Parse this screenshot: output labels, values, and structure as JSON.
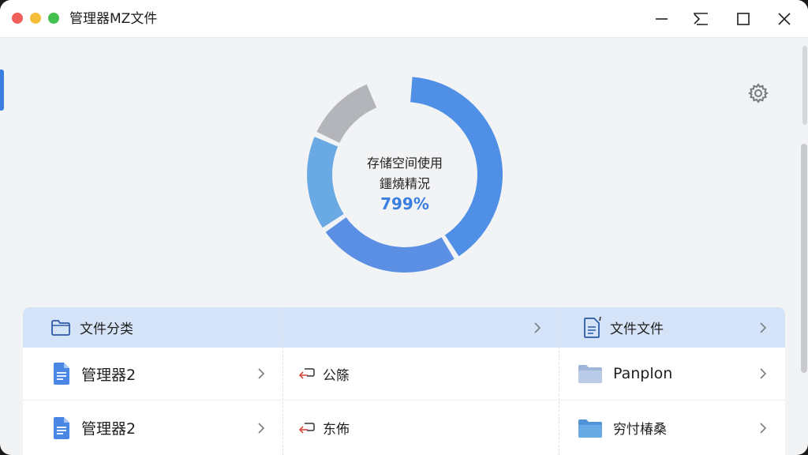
{
  "window": {
    "title": "管理器MZ文件"
  },
  "storage": {
    "label_line1": "存储空间使用",
    "label_line2": "鑩燒精況",
    "percent_text": "799%",
    "segments": [
      {
        "name": "primary",
        "color": "#4f8fe6",
        "fraction": 0.4
      },
      {
        "name": "secondary",
        "color": "#5b8fe3",
        "fraction": 0.24
      },
      {
        "name": "tertiary",
        "color": "#6aaae4",
        "fraction": 0.16
      },
      {
        "name": "free",
        "color": "#b3b5ba",
        "fraction": 0.12
      }
    ]
  },
  "table": {
    "header": {
      "col1_label": "文件分类",
      "col3_label": "文件文件"
    },
    "rows": [
      {
        "col1_label": "管理器2",
        "col2_label": "公篨",
        "col3_label": "Panplon"
      },
      {
        "col1_label": "管理器2",
        "col2_label": "东佈",
        "col3_label": "穷忖椿桑"
      }
    ]
  },
  "icons": {
    "settings": "gear-icon",
    "folder": "folder-icon",
    "document": "document-icon",
    "link": "link-icon",
    "chevron": "chevron-right-icon"
  },
  "colors": {
    "accent": "#3a7ee0",
    "header_row": "#d4e3f8",
    "background": "#f2f3f5"
  }
}
